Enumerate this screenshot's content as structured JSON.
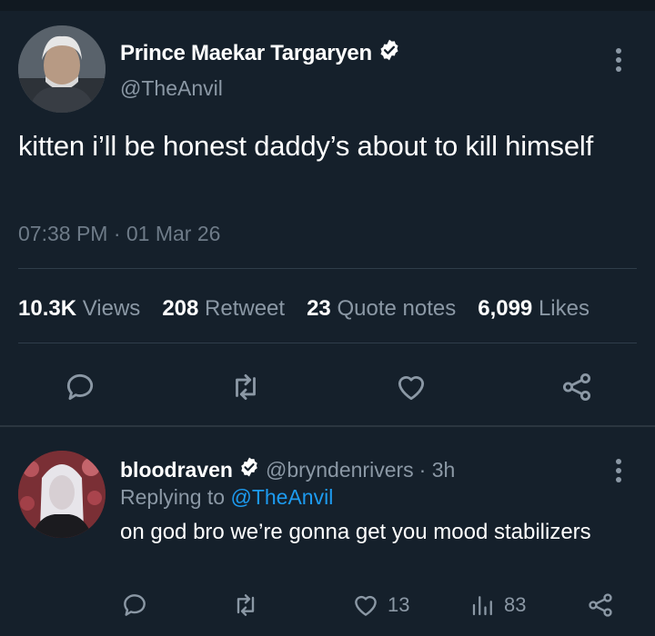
{
  "tweet": {
    "author_name": "Prince Maekar Targaryen",
    "author_handle": "@TheAnvil",
    "text": "kitten i’ll be honest daddy’s about to kill himself",
    "time": "07:38 PM · 01 Mar 26",
    "stats": {
      "views_count": "10.3K",
      "views_label": "Views",
      "retweet_count": "208",
      "retweet_label": "Retweet",
      "quote_count": "23",
      "quote_label": "Quote notes",
      "likes_count": "6,099",
      "likes_label": "Likes"
    }
  },
  "reply": {
    "author_name": "bloodraven",
    "author_handle": "@bryndenrivers",
    "time": "· 3h",
    "replying_prefix": "Replying to",
    "replying_handle": "@TheAnvil",
    "text": "on god bro we’re gonna get you mood stabilizers",
    "likes": "13",
    "views": "83"
  },
  "colors": {
    "background": "#15202b",
    "muted_text": "#8b98a5",
    "link": "#1d9bf0",
    "verified": "#ffffff"
  },
  "icons": [
    "verified-badge-icon",
    "more-vertical-icon",
    "reply-icon",
    "retweet-icon",
    "like-icon",
    "share-icon",
    "views-icon"
  ]
}
